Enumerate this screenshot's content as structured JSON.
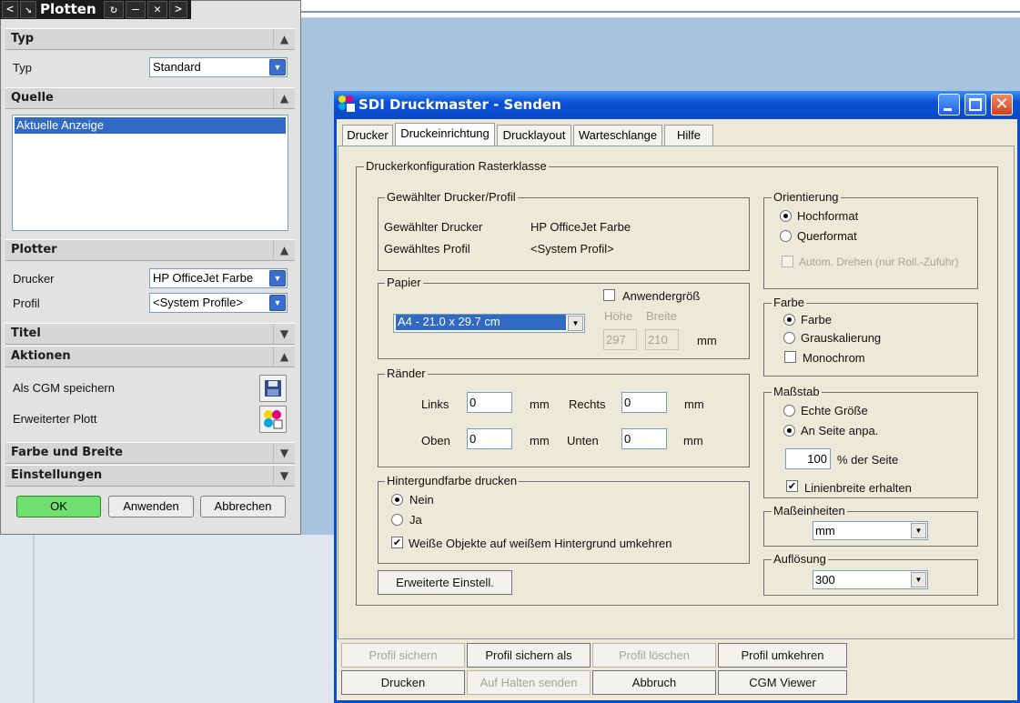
{
  "plot_panel": {
    "title": "Plotten",
    "title_buttons": [
      "<",
      "↘",
      "↻",
      "—",
      "✕",
      ">"
    ],
    "sections": {
      "typ": {
        "header": "Typ",
        "label": "Typ",
        "value": "Standard"
      },
      "quelle": {
        "header": "Quelle",
        "items": [
          "Aktuelle Anzeige"
        ]
      },
      "plotter": {
        "header": "Plotter",
        "drucker_label": "Drucker",
        "drucker_value": "HP OfficeJet Farbe",
        "profil_label": "Profil",
        "profil_value": "<System Profile>"
      },
      "titel": {
        "header": "Titel"
      },
      "aktionen": {
        "header": "Aktionen",
        "cgm_label": "Als CGM speichern",
        "erweitert_label": "Erweiterter Plott"
      },
      "farbe": {
        "header": "Farbe und Breite"
      },
      "einstellungen": {
        "header": "Einstellungen"
      }
    },
    "buttons": {
      "ok": "OK",
      "apply": "Anwenden",
      "cancel": "Abbrechen"
    }
  },
  "dialog": {
    "title": "SDI Druckmaster - Senden",
    "tabs": [
      "Drucker",
      "Druckeinrichtung",
      "Drucklayout",
      "Warteschlange",
      "Hilfe"
    ],
    "active_tab": "Druckeinrichtung",
    "group_main": "Druckerkonfiguration Rasterklasse",
    "printer_group": {
      "legend": "Gewählter Drucker/Profil",
      "printer_label": "Gewählter Drucker",
      "printer_value": "HP OfficeJet Farbe",
      "profile_label": "Gewähltes Profil",
      "profile_value": "<System Profil>"
    },
    "paper": {
      "legend": "Papier",
      "size": "A4 - 21.0 x 29.7 cm",
      "custom_label": "Anwendergröß",
      "height_label": "Höhe",
      "width_label": "Breite",
      "height": "297",
      "width": "210",
      "unit": "mm"
    },
    "margins": {
      "legend": "Ränder",
      "links": "Links",
      "rechts": "Rechts",
      "oben": "Oben",
      "unten": "Unten",
      "links_val": "0",
      "rechts_val": "0",
      "oben_val": "0",
      "unten_val": "0",
      "unit": "mm"
    },
    "background": {
      "legend": "Hintergundfarbe drucken",
      "no": "Nein",
      "yes": "Ja",
      "invert": "Weiße Objekte auf weißem Hintergrund umkehren"
    },
    "advanced_button": "Erweiterte Einstell.",
    "orientation": {
      "legend": "Orientierung",
      "portrait": "Hochformat",
      "landscape": "Querformat",
      "autorotate": "Autom. Drehen (nur Roll.-Zufuhr)"
    },
    "color": {
      "legend": "Farbe",
      "color": "Farbe",
      "gray": "Grauskalierung",
      "mono": "Monochrom"
    },
    "scale": {
      "legend": "Maßstab",
      "real": "Echte Größe",
      "fit": "An Seite anpa.",
      "percent": "100",
      "percent_label": "% der Seite",
      "linewidth": "Linienbreite erhalten"
    },
    "units": {
      "legend": "Maßeinheiten",
      "value": "mm"
    },
    "resolution": {
      "legend": "Auflösung",
      "value": "300"
    },
    "footer": {
      "save_profile": "Profil sichern",
      "save_profile_as": "Profil sichern als",
      "delete_profile": "Profil löschen",
      "reverse_profile": "Profil umkehren",
      "print": "Drucken",
      "hold": "Auf Halten senden",
      "abort": "Abbruch",
      "cgm_viewer": "CGM Viewer"
    }
  }
}
